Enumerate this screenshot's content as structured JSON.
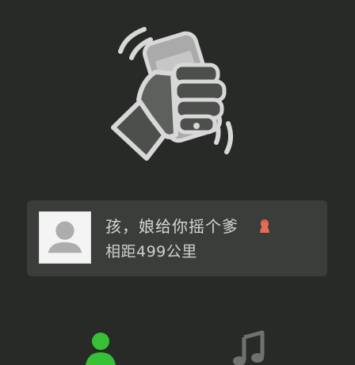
{
  "result_card": {
    "name": "孩，娘给你摇个爹",
    "distance": "相距499公里"
  },
  "icons": {
    "shake": "shake-phone-icon",
    "avatar": "default-avatar-icon",
    "gender": "female-icon",
    "tab_people": "person-icon",
    "tab_music": "music-note-icon"
  },
  "colors": {
    "background": "#272a27",
    "card": "#3a3d3a",
    "active_tab": "#35c035",
    "inactive_tab": "#6f726f",
    "female_badge": "#e86b53"
  }
}
